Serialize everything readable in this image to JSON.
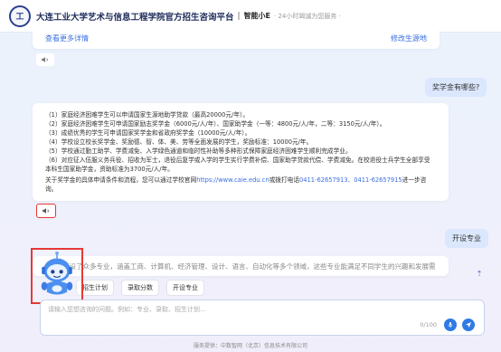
{
  "header": {
    "logo_text": "工",
    "title": "大连工业大学艺术与信息工程学院官方招生咨询平台",
    "separator": "|",
    "bot_name": "智能小E",
    "subtitle": "· 24小时竭诚为您服务 ·"
  },
  "top_card": {
    "left_link": "查看更多详情",
    "right_link": "修改生源地"
  },
  "question_1": "奖学金有哪些?",
  "answer": {
    "lines": [
      "（1）家庭经济困难学生可以申请国家生源地助学贷款（最高20000元/年）。",
      "（2）家庭经济困难学生可申请国家励志奖学金（6000元/人/年）、国家助学金（一等：4800元/人/年，二等：3150元/人/年）。",
      "（3）成绩优秀的学生可申请国家奖学金和省政府奖学金（10000元/人/年）。",
      "（4）学校设立校长奖学金、奖励德、智、体、美、劳等全面发展的学生，奖励标准：10000元/年。",
      "（5）学校通过勤工助学、学费减免、入学绿色通道和临时性补助等多种形式保障家庭经济困难学生顺利完成学业。",
      "（6）对应征入伍服义务兵役、招收为军士，退役后复学或入学的学生实行学费补偿、国家助学贷款代偿、学费减免。在校退役士兵学生全部享受本科生国家助学金，资助标准为3700元/人/年。"
    ],
    "outro_prefix": "关于奖学金的具体申请条件和流程，您可以通过学校官网",
    "outro_site": "https://www.caie.edu.cn",
    "outro_mid": "或拨打电话",
    "outro_phone": "0411-62657913、0411-62657915",
    "outro_suffix": "进一步咨询。"
  },
  "question_2": "开设专业",
  "partial_answer": "学校开设了众多专业，涵盖工商、计算机、经济管理、设计、语言、自动化等多个领域，这些专业能满足不同学生的兴趣和发展需",
  "quick_actions": [
    "招生计划",
    "录取分数",
    "开设专业"
  ],
  "input": {
    "placeholder": "请输入您想咨询的问题。例如：专业、录取、招生计划...",
    "counter": "0/100"
  },
  "footer": "服务提供：中数智网（北京）信息技术有限公司",
  "colors": {
    "accent": "#3b6fe0",
    "question_bubble": "#dbe7fd",
    "highlight_box": "#e53935",
    "send_button": "#2f7be6"
  },
  "icons": {
    "speaker": "speaker-icon",
    "mic": "mic-icon",
    "send": "send-icon",
    "back_to_top": "arrow-up-icon",
    "mascot": "robot-mascot-icon"
  }
}
